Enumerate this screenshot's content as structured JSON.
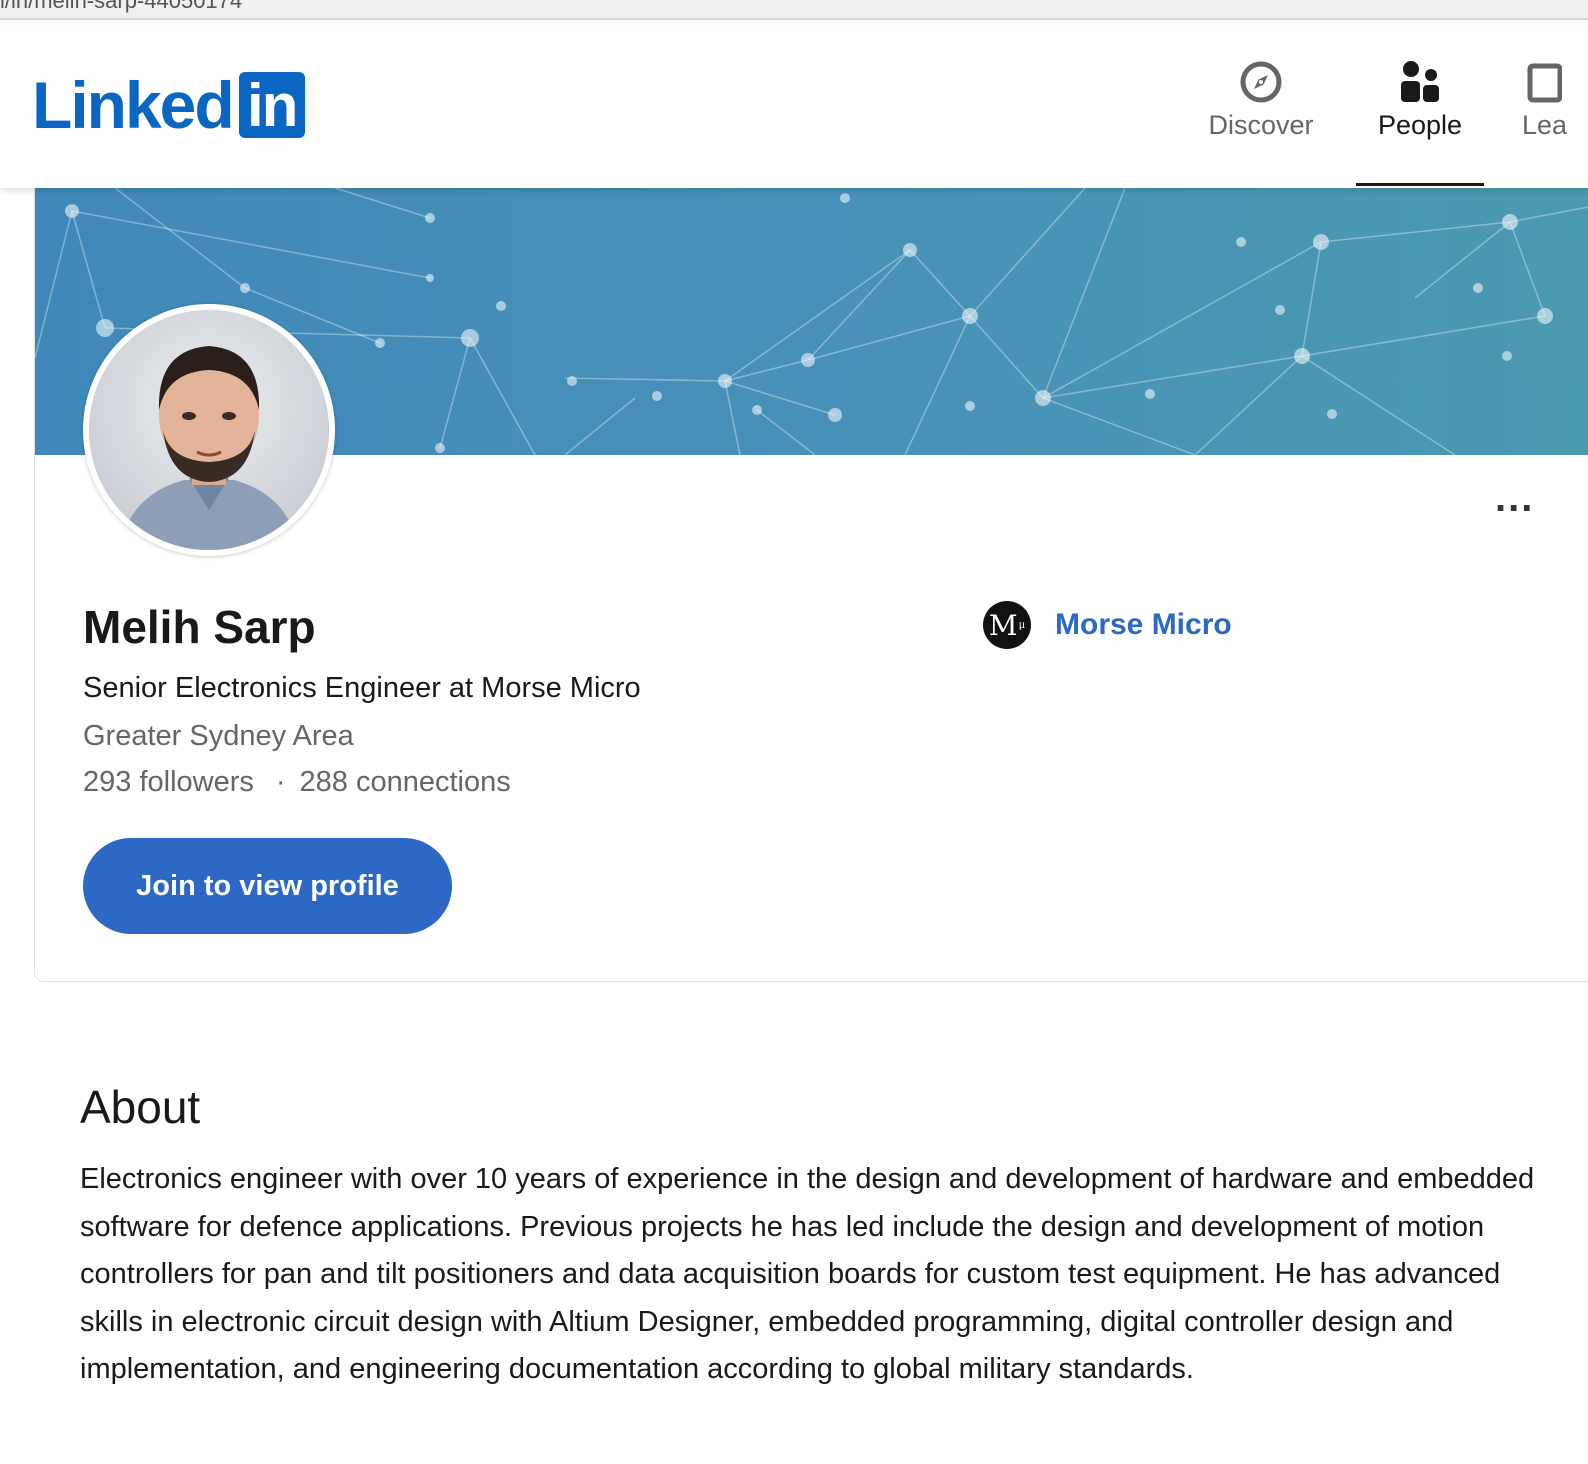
{
  "browser": {
    "url_fragment": "i/in/melih-sarp-44050174"
  },
  "nav": {
    "logo_text": "Linked",
    "logo_box_text": "in",
    "items": [
      {
        "label": "Discover",
        "icon": "compass-icon"
      },
      {
        "label": "People",
        "icon": "people-icon",
        "active": true
      },
      {
        "label": "Lea",
        "icon": "learning-icon"
      }
    ]
  },
  "profile": {
    "name": "Melih Sarp",
    "headline": "Senior Electronics Engineer at Morse Micro",
    "location": "Greater Sydney Area",
    "followers": "293 followers",
    "separator": "·",
    "connections": "288 connections",
    "join_button": "Join to view profile",
    "more_menu": "..."
  },
  "company": {
    "logo_letter": "M",
    "logo_sub": "μ",
    "name": "Morse Micro"
  },
  "about": {
    "title": "About",
    "text": "Electronics engineer with over 10 years of experience in the design and development of hardware and embedded software for defence applications. Previous projects he has led include the design and development of motion controllers for pan and tilt positioners and data acquisition boards for custom test equipment. He has advanced skills in electronic circuit design with Altium Designer, embedded programming, digital controller design and implementation, and engineering documentation according to global military standards."
  },
  "colors": {
    "brand": "#0a66c2",
    "button": "#2d68c4",
    "banner": "#4892b8"
  }
}
